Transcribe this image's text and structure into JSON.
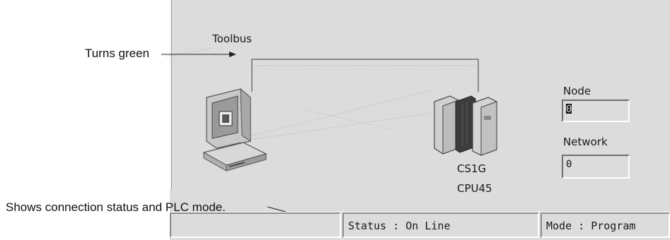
{
  "annotations": {
    "toolbus_callout": "Turns green",
    "status_callout": "Shows connection status and PLC mode."
  },
  "diagram": {
    "toolbus_label": "Toolbus",
    "plc_model_line1": "CS1G",
    "plc_model_line2": "CPU45"
  },
  "fields": {
    "node_label": "Node",
    "node_value": "0",
    "network_label": "Network",
    "network_value": "0"
  },
  "statusbar": {
    "status_text": "Status : On Line",
    "mode_text": "Mode : Program"
  },
  "icons": {
    "computer": "computer-icon",
    "plc": "plc-icon"
  }
}
